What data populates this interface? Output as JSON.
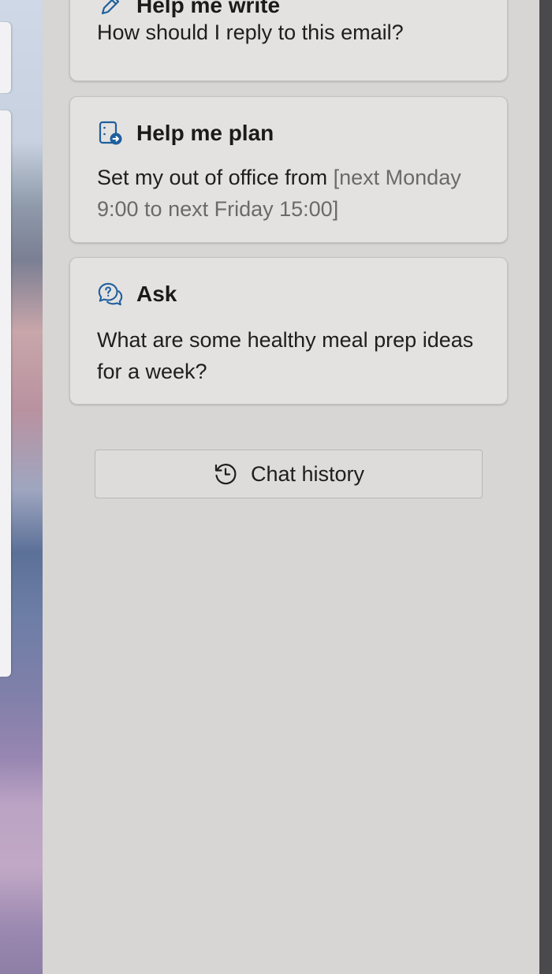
{
  "suggestions": [
    {
      "icon": "pen-sparkle-icon",
      "title": "Help me write",
      "prompt": "How should I reply to this email?",
      "prompt_hint": ""
    },
    {
      "icon": "calendar-arrow-icon",
      "title": "Help me plan",
      "prompt": "Set my out of office from ",
      "prompt_hint": "[next Monday 9:00 to next Friday 15:00]"
    },
    {
      "icon": "chat-question-icon",
      "title": "Ask",
      "prompt": "What are some healthy meal prep ideas for a week?",
      "prompt_hint": ""
    }
  ],
  "chat_history_button": {
    "icon": "history-clock-icon",
    "label": "Chat history"
  },
  "colors": {
    "accent_icon": "#1f5f9e",
    "pane_background": "#d7d6d4",
    "card_background": "#e3e2e0",
    "hint_text": "#6a6a6a"
  }
}
